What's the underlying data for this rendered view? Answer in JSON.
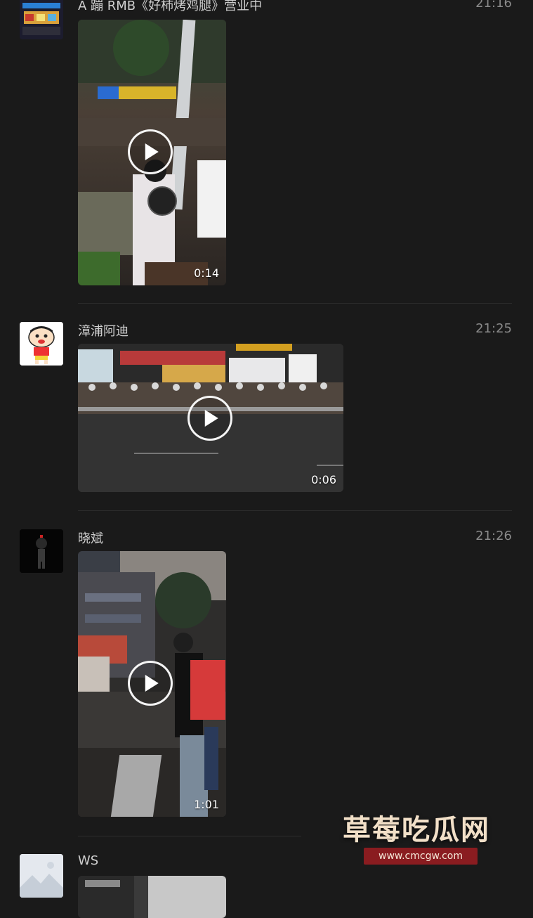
{
  "posts": [
    {
      "name": "A 蹦 RMB《好柿烤鸡腿》营业中",
      "time": "21:16",
      "duration": "0:14",
      "avatar_icon": "storefront-avatar"
    },
    {
      "name": "漳浦阿迪",
      "time": "21:25",
      "duration": "0:06",
      "avatar_icon": "cartoon-boy-avatar"
    },
    {
      "name": "晓斌",
      "time": "21:26",
      "duration": "1:01",
      "avatar_icon": "figure-dark-avatar"
    },
    {
      "name": "WS",
      "time": "",
      "duration": "",
      "avatar_icon": "landscape-placeholder-avatar"
    }
  ],
  "watermark": {
    "title": "草莓吃瓜网",
    "url": "www.cmcgw.com"
  },
  "colors": {
    "background": "#1a1a1a",
    "divider": "#2c2c2c",
    "name": "#cfcfcf",
    "time": "#8a8a8a"
  }
}
